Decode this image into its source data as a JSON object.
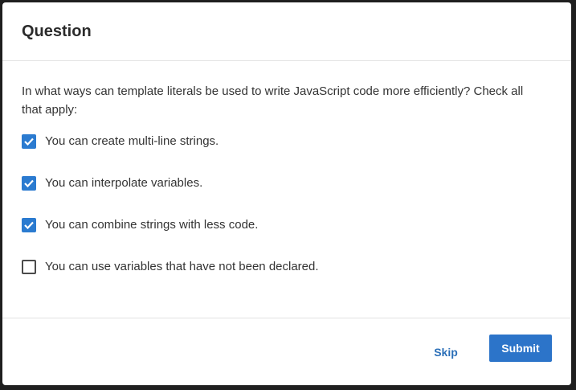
{
  "dialog": {
    "title": "Question",
    "prompt": "In what ways can template literals be used to write JavaScript code more efficiently? Check all that apply:",
    "options": [
      {
        "label": "You can create multi-line strings.",
        "checked": true
      },
      {
        "label": "You can interpolate variables.",
        "checked": true
      },
      {
        "label": "You can combine strings with less code.",
        "checked": true
      },
      {
        "label": "You can use variables that have not been declared.",
        "checked": false
      }
    ],
    "skip_label": "Skip",
    "submit_label": "Submit"
  },
  "colors": {
    "accent": "#2c74c9",
    "skip_text": "#2b6fb8",
    "text": "#333333"
  },
  "icons": {
    "checked": "check-icon"
  }
}
